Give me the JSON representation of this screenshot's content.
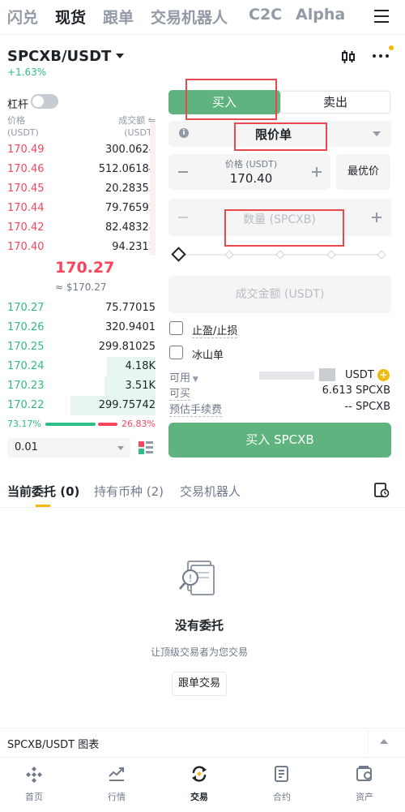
{
  "top_nav": {
    "tabs": [
      "闪兑",
      "现货",
      "跟单",
      "交易机器人",
      "C2C",
      "Alpha"
    ],
    "active": "现货"
  },
  "pair": {
    "symbol": "SPCXB/USDT",
    "change": "+1.63%"
  },
  "leverage_label": "杠杆",
  "orderbook": {
    "price_header": "价格",
    "price_unit": "(USDT)",
    "amount_header": "成交额 ⇋",
    "amount_unit": "(USDT)",
    "asks": [
      {
        "price": "170.49",
        "amount": "300.0624"
      },
      {
        "price": "170.46",
        "amount": "512.06184"
      },
      {
        "price": "170.45",
        "amount": "20.28355"
      },
      {
        "price": "170.44",
        "amount": "79.76592"
      },
      {
        "price": "170.42",
        "amount": "82.48328"
      },
      {
        "price": "170.40",
        "amount": "94.2312"
      }
    ],
    "last_price": "170.27",
    "last_price_usd": "≈ $170.27",
    "bids": [
      {
        "price": "170.27",
        "amount": "75.77015",
        "depth": 0.0
      },
      {
        "price": "170.26",
        "amount": "320.9401",
        "depth": 0.0
      },
      {
        "price": "170.25",
        "amount": "299.81025",
        "depth": 0.0
      },
      {
        "price": "170.24",
        "amount": "4.18K",
        "depth": 0.57
      },
      {
        "price": "170.23",
        "amount": "3.51K",
        "depth": 0.6
      },
      {
        "price": "170.22",
        "amount": "299.75742",
        "depth": 1.0
      }
    ],
    "buy_ratio": "73.17%",
    "sell_ratio": "26.83%",
    "depth_precision": "0.01"
  },
  "trade_form": {
    "buy_tab": "买入",
    "sell_tab": "卖出",
    "order_type": "限价单",
    "price_label": "价格 (USDT)",
    "price_value": "170.40",
    "best_price": "最优价",
    "quantity_placeholder": "数量 (SPCXB)",
    "total_placeholder": "成交金额 (USDT)",
    "tp_sl_label": "止盈/止损",
    "iceberg_label": "冰山单",
    "available_label": "可用",
    "available_unit": "USDT",
    "can_buy_label": "可买",
    "can_buy_value": "6.613 SPCXB",
    "fee_label": "预估手续费",
    "fee_value": "-- SPCXB",
    "buy_button": "买入 SPCXB",
    "accent_color": "#5eb37f"
  },
  "orders": {
    "tabs": [
      "当前委托 (0)",
      "持有币种 (2)",
      "交易机器人"
    ],
    "empty_title": "没有委托",
    "empty_subtitle": "让顶级交易者为您交易",
    "copy_button": "跟单交易"
  },
  "chart_bar": {
    "label": "SPCXB/USDT 图表"
  },
  "bottom_nav": {
    "items": [
      {
        "label": "首页",
        "icon": "home-icon"
      },
      {
        "label": "行情",
        "icon": "markets-icon"
      },
      {
        "label": "交易",
        "icon": "trade-icon"
      },
      {
        "label": "合约",
        "icon": "futures-icon"
      },
      {
        "label": "资产",
        "icon": "wallet-icon"
      }
    ],
    "active": "交易"
  }
}
